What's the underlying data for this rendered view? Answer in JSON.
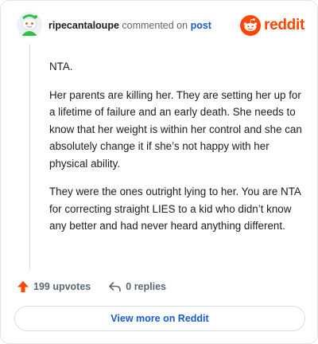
{
  "header": {
    "username": "ripecantaloupe",
    "action": "commented on",
    "link_text": "post",
    "brand_word": "reddit",
    "brand_color": "#ff4500"
  },
  "comment": {
    "paragraphs": [
      "NTA.",
      "Her parents are killing her. They are setting her up for a lifetime of failure and an early death. She needs to know that her weight is within her control and she can absolutely change it if she’s not happy with her physical ability.",
      "They were the ones outright lying to her. You are NTA for correcting straight LIES to a kid who didn’t know any better and had never heard anything different."
    ]
  },
  "footer": {
    "upvotes_label": "199 upvotes",
    "replies_label": "0 replies",
    "upvote_icon": "upvote-arrow-icon",
    "reply_icon": "reply-arrow-icon"
  },
  "cta": {
    "label": "View more on Reddit"
  },
  "colors": {
    "accent": "#ff4500",
    "link": "#1a5cc8",
    "muted": "#5b6770"
  }
}
